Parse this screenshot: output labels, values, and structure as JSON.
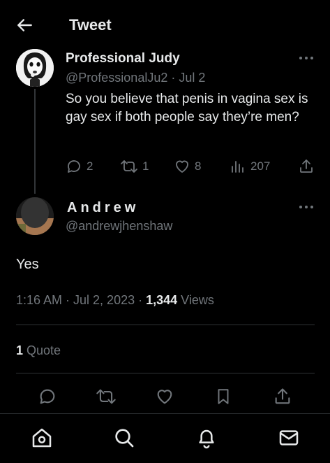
{
  "header": {
    "title": "Tweet",
    "back_icon": "arrow-left-icon"
  },
  "parent_tweet": {
    "name": "Professional Judy",
    "handle": "@ProfessionalJu2",
    "date": "Jul 2",
    "handle_line": "@ProfessionalJu2 · Jul 2",
    "text": "So you believe that penis in vagina sex is gay sex if both people say they’re men?",
    "replies": "2",
    "retweets": "1",
    "likes": "8",
    "views": "207"
  },
  "main_tweet": {
    "name": "Andrew",
    "handle": "@andrewjhenshaw",
    "text": "Yes",
    "time_date": "1:16 AM · Jul 2, 2023 · ",
    "views_count": "1,344",
    "views_label": " Views",
    "quote_count": "1",
    "quote_label": " Quote"
  },
  "nav": {
    "items": [
      "home-icon",
      "search-icon",
      "notifications-icon",
      "messages-icon"
    ]
  },
  "colors": {
    "background": "#000000",
    "text": "#e7e9ea",
    "muted": "#71767b",
    "divider": "#2f3336"
  }
}
